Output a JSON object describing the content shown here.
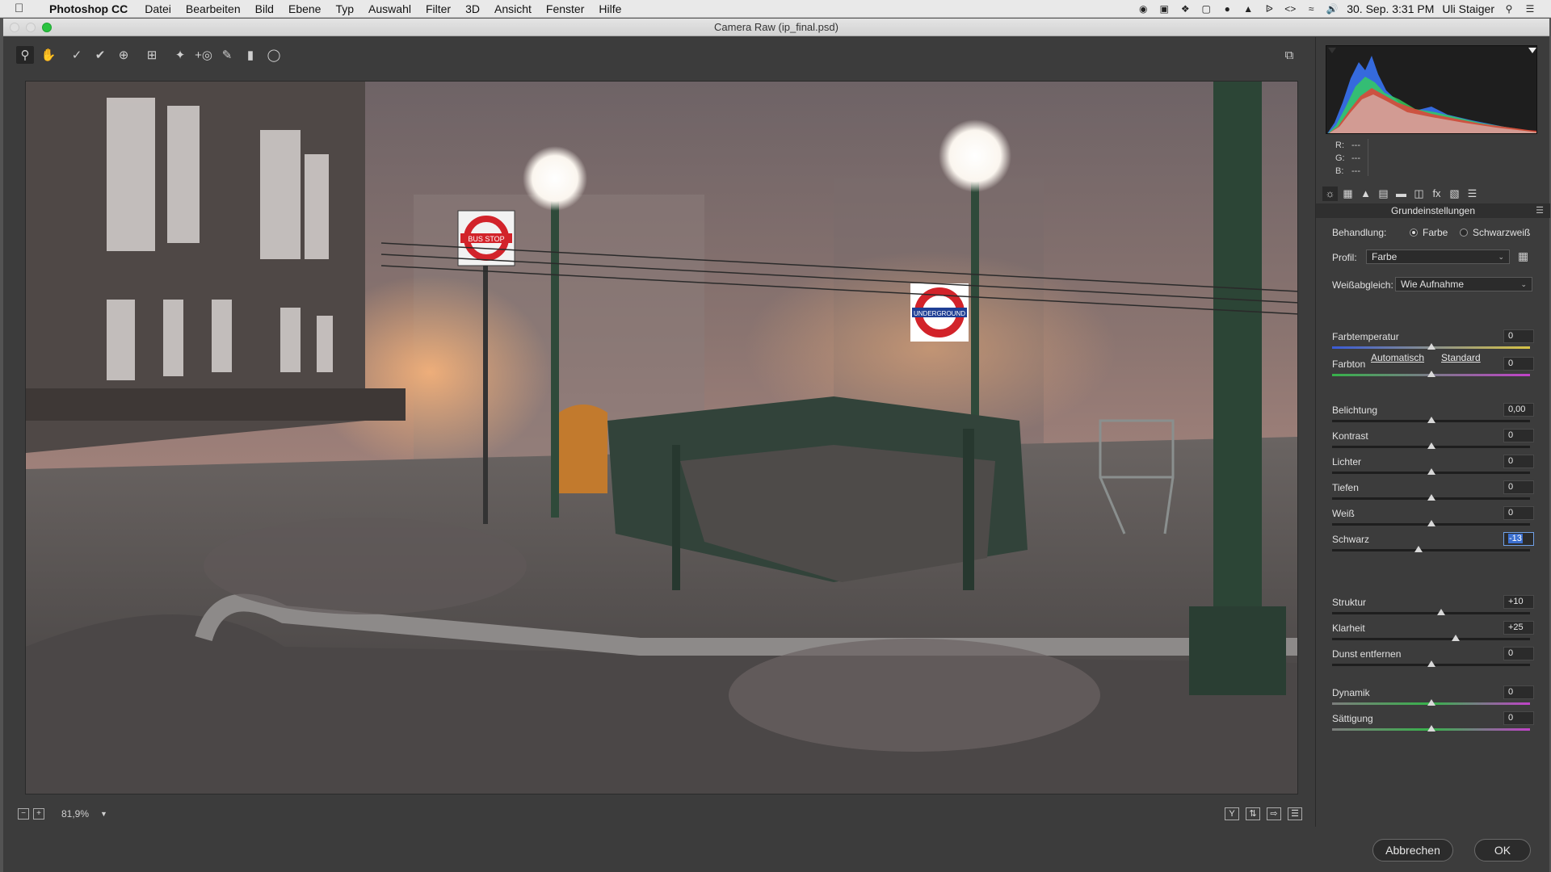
{
  "menubar": {
    "apple_icon": "apple-icon",
    "items": [
      "Photoshop CC",
      "Datei",
      "Bearbeiten",
      "Bild",
      "Ebene",
      "Typ",
      "Auswahl",
      "Filter",
      "3D",
      "Ansicht",
      "Fenster",
      "Hilfe"
    ],
    "datetime": "30. Sep.  3:31 PM",
    "user": "Uli Staiger"
  },
  "window": {
    "title": "Camera Raw (ip_final.psd)"
  },
  "preview": {
    "zoom": "81,9%",
    "bus_stop_sign": "BUS STOP",
    "underground_sign": "UNDERGROUND"
  },
  "panel": {
    "rgb": {
      "r_label": "R:",
      "r_value": "---",
      "g_label": "G:",
      "g_value": "---",
      "b_label": "B:",
      "b_value": "---"
    },
    "section_title": "Grundeinstellungen",
    "behandlung_label": "Behandlung:",
    "treatment_color": "Farbe",
    "treatment_bw": "Schwarzweiß",
    "treatment_selected": "Farbe",
    "profil_label": "Profil:",
    "profil_value": "Farbe",
    "weissabgleich_label": "Weißabgleich:",
    "weissabgleich_value": "Wie Aufnahme",
    "auto_link": "Automatisch",
    "default_link": "Standard",
    "sliders_wb": [
      {
        "label": "Farbtemperatur",
        "value": "0",
        "level": 0.5
      },
      {
        "label": "Farbton",
        "value": "0",
        "level": 0.5
      }
    ],
    "sliders_tone": [
      {
        "label": "Belichtung",
        "value": "0,00",
        "level": 0.5
      },
      {
        "label": "Kontrast",
        "value": "0",
        "level": 0.5
      },
      {
        "label": "Lichter",
        "value": "0",
        "level": 0.5
      },
      {
        "label": "Tiefen",
        "value": "0",
        "level": 0.5
      },
      {
        "label": "Weiß",
        "value": "0",
        "level": 0.5
      },
      {
        "label": "Schwarz",
        "value": "-13",
        "level": 0.435
      }
    ],
    "sliders_presence": [
      {
        "label": "Struktur",
        "value": "+10",
        "level": 0.55
      },
      {
        "label": "Klarheit",
        "value": "+25",
        "level": 0.625
      },
      {
        "label": "Dunst entfernen",
        "value": "0",
        "level": 0.5
      }
    ],
    "sliders_color": [
      {
        "label": "Dynamik",
        "value": "0",
        "level": 0.5
      },
      {
        "label": "Sättigung",
        "value": "0",
        "level": 0.5
      }
    ]
  },
  "buttons": {
    "cancel": "Abbrechen",
    "ok": "OK"
  },
  "colors": {
    "panel_bg": "#3c3c3c",
    "accent_blue": "#3b6fd0",
    "traffic_green": "#29c33f"
  }
}
